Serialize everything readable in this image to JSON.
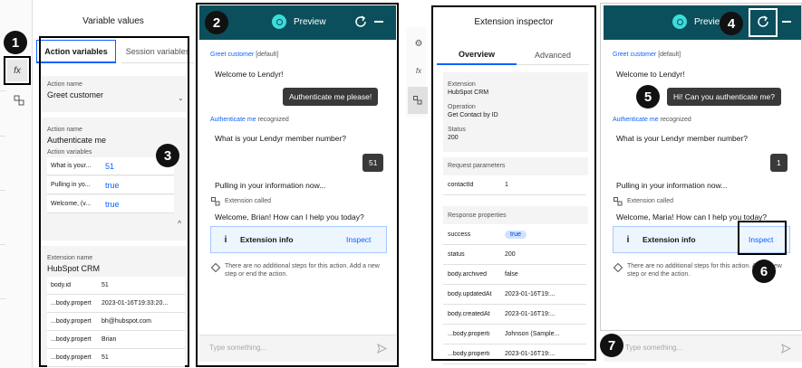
{
  "badges": [
    "1",
    "2",
    "3",
    "4",
    "5",
    "6",
    "7"
  ],
  "left_panel": {
    "title": "Variable values",
    "tab_action": "Action variables",
    "tab_session": "Session variables",
    "action1_label": "Action name",
    "action1_value": "Greet customer",
    "action2_label": "Action name",
    "action2_value": "Authenticate me",
    "action_vars_label": "Action variables",
    "vars": [
      {
        "key": "What is your...",
        "value": "51"
      },
      {
        "key": "Pulling in yo...",
        "value": "true"
      },
      {
        "key": "Welcome, (v...",
        "value": "true"
      }
    ],
    "ext_label": "Extension name",
    "ext_value": "HubSpot CRM",
    "ext_rows": [
      {
        "key": "body.id",
        "value": "51"
      },
      {
        "key": "...body.propert",
        "value": "2023-01-16T19:33:20..."
      },
      {
        "key": "...body.propert",
        "value": "bh@hubspot.com"
      },
      {
        "key": "...body.propert",
        "value": "Brian"
      },
      {
        "key": "...body.propert",
        "value": "51"
      }
    ]
  },
  "chat1": {
    "header": "Preview",
    "greet_action": "Greet customer",
    "greet_default": "[default]",
    "welcome": "Welcome to Lendyr!",
    "user1": "Authenticate me please!",
    "auth_action": "Authenticate me",
    "auth_recognized": "recognized",
    "q_member": "What is your Lendyr member number?",
    "user2": "51",
    "pulling": "Pulling in your information now...",
    "ext_called": "Extension called",
    "welcome_user": "Welcome, Brian! How can I help you today?",
    "ext_info": "Extension info",
    "inspect": "Inspect",
    "no_steps": "There are no additional steps for this action. Add a new step or end the action.",
    "placeholder": "Type something..."
  },
  "inspector": {
    "title": "Extension inspector",
    "tab_overview": "Overview",
    "tab_advanced": "Advanced",
    "ext_label": "Extension",
    "ext_value": "HubSpot CRM",
    "op_label": "Operation",
    "op_value": "Get Contact by ID",
    "status_label": "Status",
    "status_value": "200",
    "req_params": "Request parameters",
    "req_rows": [
      {
        "key": "contactId",
        "value": "1"
      }
    ],
    "resp_props": "Response properties",
    "resp_rows": [
      {
        "key": "success",
        "value": "true"
      },
      {
        "key": "status",
        "value": "200"
      },
      {
        "key": "body.archived",
        "value": "false"
      },
      {
        "key": "body.updatedAt",
        "value": "2023-01-16T19:..."
      },
      {
        "key": "body.createdAt",
        "value": "2023-01-16T19:..."
      },
      {
        "key": "...body.properti",
        "value": "Johnson (Sample..."
      },
      {
        "key": "...body.properti",
        "value": "2023-01-16T19:..."
      }
    ]
  },
  "chat2": {
    "header": "Preview",
    "greet_action": "Greet customer",
    "greet_default": "[default]",
    "welcome": "Welcome to Lendyr!",
    "user1": "Hi! Can you authenticate me?",
    "auth_action": "Authenticate me",
    "auth_recognized": "recognized",
    "q_member": "What is your Lendyr member number?",
    "user2": "1",
    "pulling": "Pulling in your information now...",
    "ext_called": "Extension called",
    "welcome_user": "Welcome, Maria! How can I help you today?",
    "ext_info": "Extension info",
    "inspect": "Inspect",
    "no_steps": "There are no additional steps for this action. Add a new step or end the action.",
    "placeholder": "Type something..."
  },
  "toolbar": {
    "fx_icon": "fx"
  }
}
